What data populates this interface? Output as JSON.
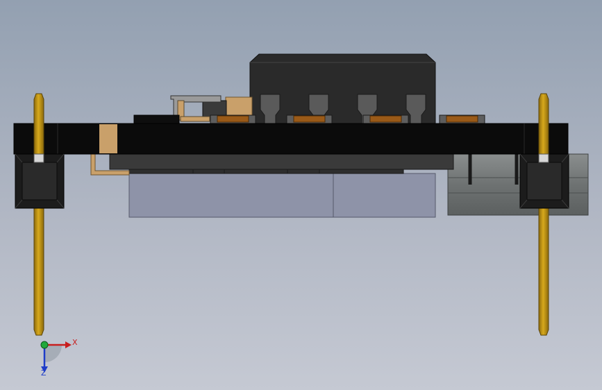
{
  "viewport": {
    "background_top": "#93a0b1",
    "background_bottom": "#c5c9d3"
  },
  "colors": {
    "pcb": "#0b0b0b",
    "header_pin": "#c79a16",
    "header_block": "#1c1c1c",
    "connector_body": "#2a2a2a",
    "pad_copper": "#9a5a18",
    "tan_component": "#c9a06a",
    "gray_component": "#8e93a8",
    "cylinder": "#777b7b",
    "x_axis": "#c81e1e",
    "y_axis": "#22a83a",
    "z_axis": "#1e3cc8"
  },
  "triad": {
    "x_label": "X",
    "z_label": "Z"
  }
}
